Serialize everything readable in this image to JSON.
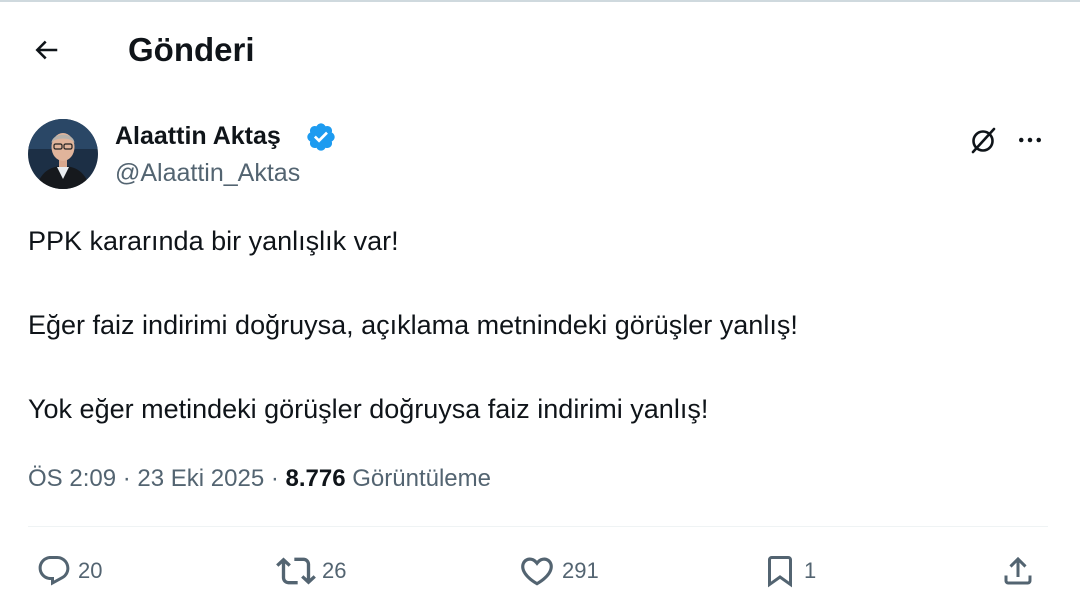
{
  "header": {
    "title": "Gönderi",
    "back_icon": "arrow-left-icon"
  },
  "tweet": {
    "author": {
      "name": "Alaattin Aktaş",
      "handle": "@Alaattin_Aktas",
      "verified": true,
      "verified_color": "#1d9bf0"
    },
    "text": [
      "PPK kararında bir yanlışlık var!",
      "Eğer faiz indirimi doğruysa, açıklama metnindeki görüşler yanlış!",
      "Yok eğer metindeki görüşler doğruysa faiz indirimi yanlış!"
    ],
    "time": "ÖS 2:09",
    "date": "23 Eki 2025",
    "separator": "·",
    "views_count": "8.776",
    "views_label": "Görüntüleme"
  },
  "actions": {
    "replies": "20",
    "reposts": "26",
    "likes": "291",
    "bookmarks": "1"
  },
  "colors": {
    "text": "#0f1419",
    "secondary": "#536471",
    "accent": "#1d9bf0",
    "divider": "#eff3f4"
  }
}
